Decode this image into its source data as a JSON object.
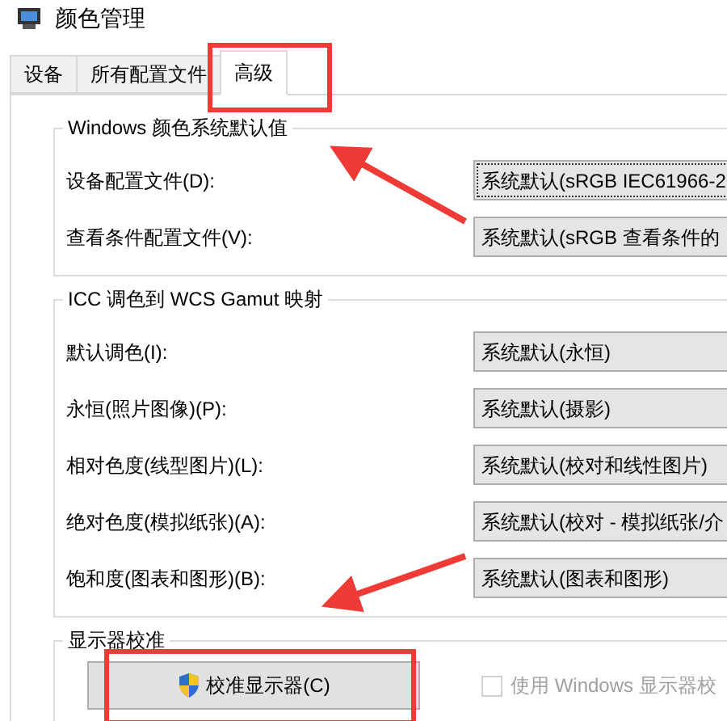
{
  "window": {
    "title": "颜色管理"
  },
  "tabs": [
    {
      "label": "设备",
      "selected": false
    },
    {
      "label": "所有配置文件",
      "selected": false
    },
    {
      "label": "高级",
      "selected": true
    }
  ],
  "groups": [
    {
      "title": "Windows 颜色系统默认值",
      "rows": [
        {
          "label": "设备配置文件(D):",
          "value": "系统默认(sRGB IEC61966-2"
        },
        {
          "label": "查看条件配置文件(V):",
          "value": "系统默认(sRGB 查看条件的"
        }
      ]
    },
    {
      "title": "ICC 调色到 WCS Gamut 映射",
      "rows": [
        {
          "label": "默认调色(I):",
          "value": "系统默认(永恒)"
        },
        {
          "label": "永恒(照片图像)(P):",
          "value": "系统默认(摄影)"
        },
        {
          "label": "相对色度(线型图片)(L):",
          "value": "系统默认(校对和线性图片)"
        },
        {
          "label": "绝对色度(模拟纸张)(A):",
          "value": "系统默认(校对 - 模拟纸张/介"
        },
        {
          "label": "饱和度(图表和图形)(B):",
          "value": "系统默认(图表和图形)"
        }
      ]
    }
  ],
  "calibration": {
    "title": "显示器校准",
    "button": "校准显示器(C)",
    "checkbox": {
      "label": "使用 Windows 显示器校",
      "checked": false,
      "disabled": true
    }
  }
}
